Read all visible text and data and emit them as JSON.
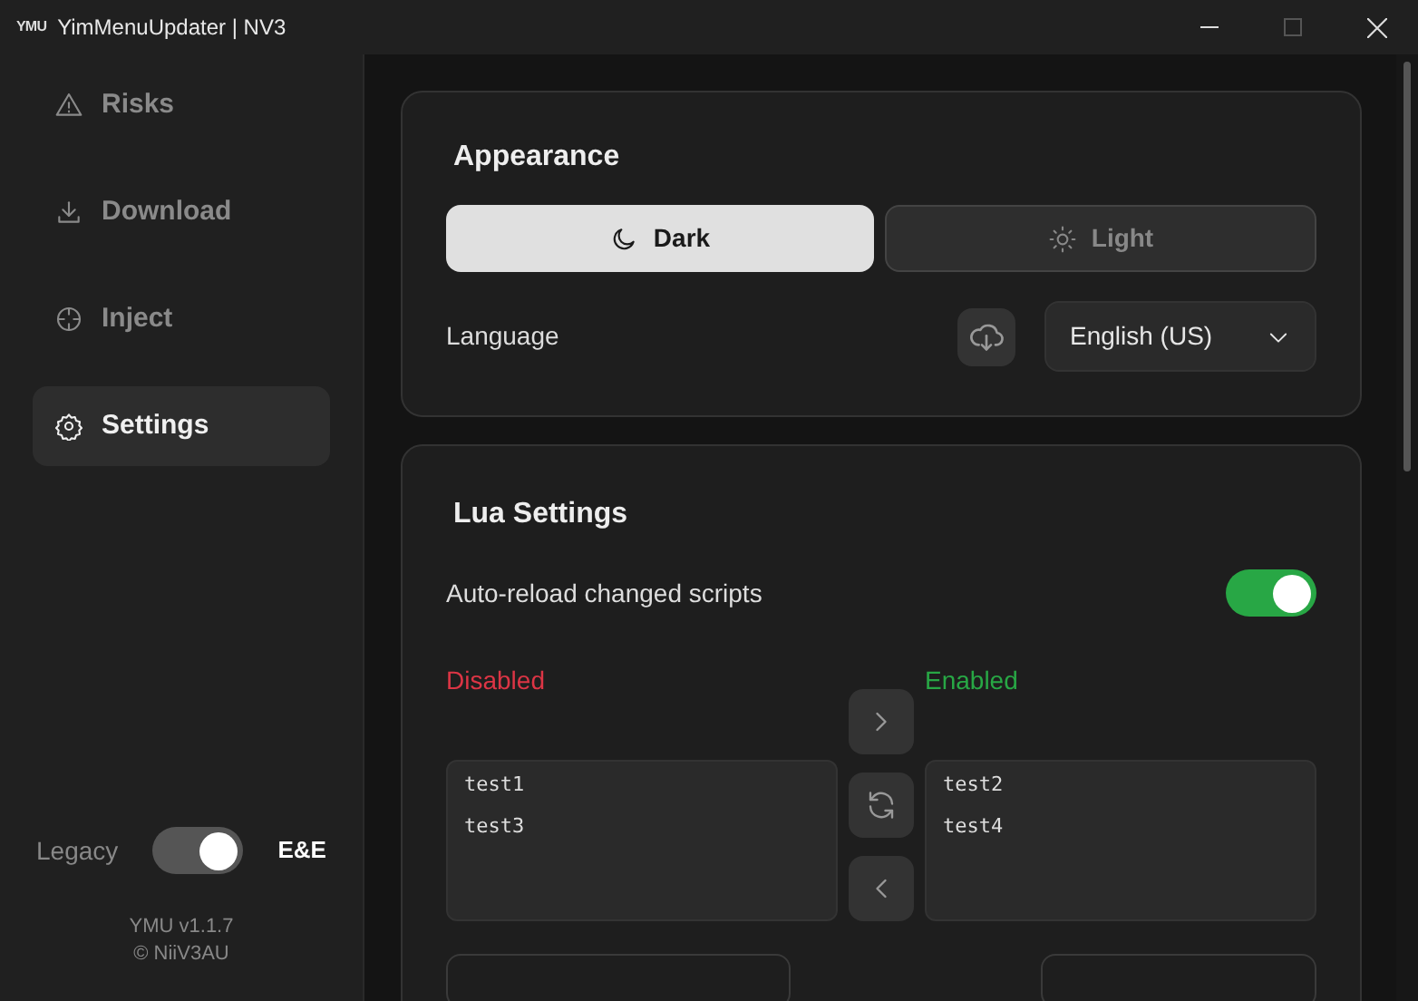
{
  "window": {
    "logo": "YMU",
    "title": "YimMenuUpdater | NV3",
    "maximize_disabled": true
  },
  "sidebar": {
    "items": [
      {
        "label": "Risks",
        "kind": "warning",
        "selected": false
      },
      {
        "label": "Download",
        "kind": "download",
        "selected": false
      },
      {
        "label": "Inject",
        "kind": "crosshair",
        "selected": false
      },
      {
        "label": "Settings",
        "kind": "gear",
        "selected": true
      }
    ],
    "mode_switch": {
      "left_label": "Legacy",
      "right_label": "E&E",
      "on": true
    },
    "version": "YMU v1.1.7",
    "credit": "© NiiV3AU"
  },
  "appearance": {
    "title": "Appearance",
    "themes": [
      {
        "label": "Dark",
        "kind": "moon",
        "selected": true
      },
      {
        "label": "Light",
        "kind": "sun",
        "selected": false
      }
    ],
    "language_label": "Language",
    "language": "English (US)"
  },
  "lua": {
    "title": "Lua Settings",
    "auto_reload_label": "Auto-reload changed scripts",
    "auto_reload": true,
    "disabled_label": "Disabled",
    "enabled_label": "Enabled",
    "disabled_scripts": [
      "test1",
      "test3"
    ],
    "enabled_scripts": [
      "test2",
      "test4"
    ]
  }
}
